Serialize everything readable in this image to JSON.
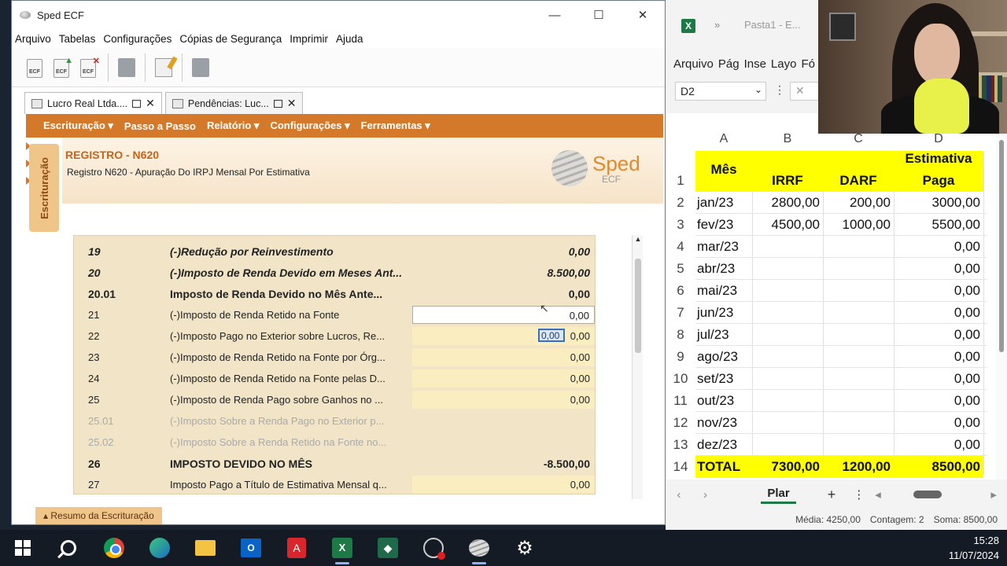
{
  "sped": {
    "title": "Sped ECF",
    "window_controls": {
      "minimize": "—",
      "maximize": "☐",
      "close": "✕"
    },
    "menu": [
      "Arquivo",
      "Tabelas",
      "Configurações",
      "Cópias de Segurança",
      "Imprimir",
      "Ajuda"
    ],
    "toolbar": {
      "ecf_label": "ECF"
    },
    "tabs": [
      {
        "label": "Lucro Real Ltda....",
        "active": true
      },
      {
        "label": "Pendências: Luc...",
        "active": false
      }
    ],
    "tab_close": "✕",
    "orange_menu": [
      "Escrituração ▾",
      "Passo a Passo",
      "Relatório ▾",
      "Configurações ▾",
      "Ferramentas ▾"
    ],
    "side_tab": "Escrituração",
    "register": {
      "title": "REGISTRO - N620",
      "subtitle": "Registro N620 - Apuração Do IRPJ Mensal Por Estimativa"
    },
    "logo": {
      "word": "Sped",
      "sub": "ECF"
    },
    "rows": [
      {
        "num": "19",
        "desc": "(-)Redução por Reinvestimento",
        "value": "0,00",
        "style": "italic-bold"
      },
      {
        "num": "20",
        "desc": "(-)Imposto de Renda Devido em Meses Ant...",
        "value": "8.500,00",
        "style": "italic-bold"
      },
      {
        "num": "20.01",
        "desc": "Imposto de Renda Devido no Mês Ante...",
        "value": "0,00",
        "style": "bold"
      },
      {
        "num": "21",
        "desc": "(-)Imposto de Renda Retido na Fonte",
        "value": "0,00",
        "style": "selected"
      },
      {
        "num": "22",
        "desc": "(-)Imposto Pago no Exterior sobre Lucros, Re...",
        "value": "0,00",
        "style": "input",
        "editing": "0,00"
      },
      {
        "num": "23",
        "desc": "(-)Imposto de Renda Retido na Fonte por Órg...",
        "value": "0,00",
        "style": "input"
      },
      {
        "num": "24",
        "desc": "(-)Imposto de Renda Retido na Fonte pelas D...",
        "value": "0,00",
        "style": "input"
      },
      {
        "num": "25",
        "desc": "(-)Imposto de Renda Pago sobre Ganhos no ...",
        "value": "0,00",
        "style": "input"
      },
      {
        "num": "25.01",
        "desc": "(-)Imposto Sobre a Renda Pago no Exterior p...",
        "value": "",
        "style": "disabled"
      },
      {
        "num": "25.02",
        "desc": "(-)Imposto Sobre a Renda Retido na Fonte no...",
        "value": "",
        "style": "disabled"
      },
      {
        "num": "26",
        "desc": "IMPOSTO DEVIDO NO MÊS",
        "value": "-8.500,00",
        "style": "bold"
      },
      {
        "num": "27",
        "desc": "Imposto Pago a Título de Estimativa Mensal q...",
        "value": "0,00",
        "style": "input"
      }
    ],
    "footer_tab": "▴ Resumo da Escrituração"
  },
  "excel": {
    "filename": "Pasta1 - E...",
    "chevron": "»",
    "menu": [
      "Arquivo",
      "Pág",
      "Inse",
      "Layo",
      "Fó"
    ],
    "name_box": "D2",
    "fx_dots": "⋮",
    "fx_cancel": "✕",
    "columns": [
      "A",
      "B",
      "C",
      "D"
    ],
    "header_row": {
      "row": "1",
      "a": "Mês",
      "b": "IRRF",
      "c": "DARF",
      "d1": "Estimativa",
      "d2": "Paga"
    },
    "rows": [
      {
        "row": "2",
        "a": "jan/23",
        "b": "2800,00",
        "c": "200,00",
        "d": "3000,00"
      },
      {
        "row": "3",
        "a": "fev/23",
        "b": "4500,00",
        "c": "1000,00",
        "d": "5500,00"
      },
      {
        "row": "4",
        "a": "mar/23",
        "b": "",
        "c": "",
        "d": "0,00"
      },
      {
        "row": "5",
        "a": "abr/23",
        "b": "",
        "c": "",
        "d": "0,00"
      },
      {
        "row": "6",
        "a": "mai/23",
        "b": "",
        "c": "",
        "d": "0,00"
      },
      {
        "row": "7",
        "a": "jun/23",
        "b": "",
        "c": "",
        "d": "0,00"
      },
      {
        "row": "8",
        "a": "jul/23",
        "b": "",
        "c": "",
        "d": "0,00"
      },
      {
        "row": "9",
        "a": "ago/23",
        "b": "",
        "c": "",
        "d": "0,00"
      },
      {
        "row": "10",
        "a": "set/23",
        "b": "",
        "c": "",
        "d": "0,00"
      },
      {
        "row": "11",
        "a": "out/23",
        "b": "",
        "c": "",
        "d": "0,00"
      },
      {
        "row": "12",
        "a": "nov/23",
        "b": "",
        "c": "",
        "d": "0,00"
      },
      {
        "row": "13",
        "a": "dez/23",
        "b": "",
        "c": "",
        "d": "0,00"
      }
    ],
    "total_row": {
      "row": "14",
      "a": "TOTAL",
      "b": "7300,00",
      "c": "1200,00",
      "d": "8500,00"
    },
    "sheet_tab": "Plar",
    "sheet_nav": {
      "prev": "‹",
      "next": "›",
      "add": "+",
      "more": "⋮",
      "left": "◂",
      "right": "▸"
    },
    "status": {
      "media": "Média: 4250,00",
      "contagem": "Contagem: 2",
      "soma": "Soma: 8500,00"
    },
    "highlight_color": "#ffff00"
  },
  "taskbar": {
    "time": "15:28",
    "date": "11/07/2024",
    "excel_label": "X",
    "outlook_label": "O",
    "pdf_label": "A",
    "gear": "⚙"
  },
  "colors": {
    "sped_orange": "#d4792a",
    "excel_green": "#1d7a45"
  }
}
